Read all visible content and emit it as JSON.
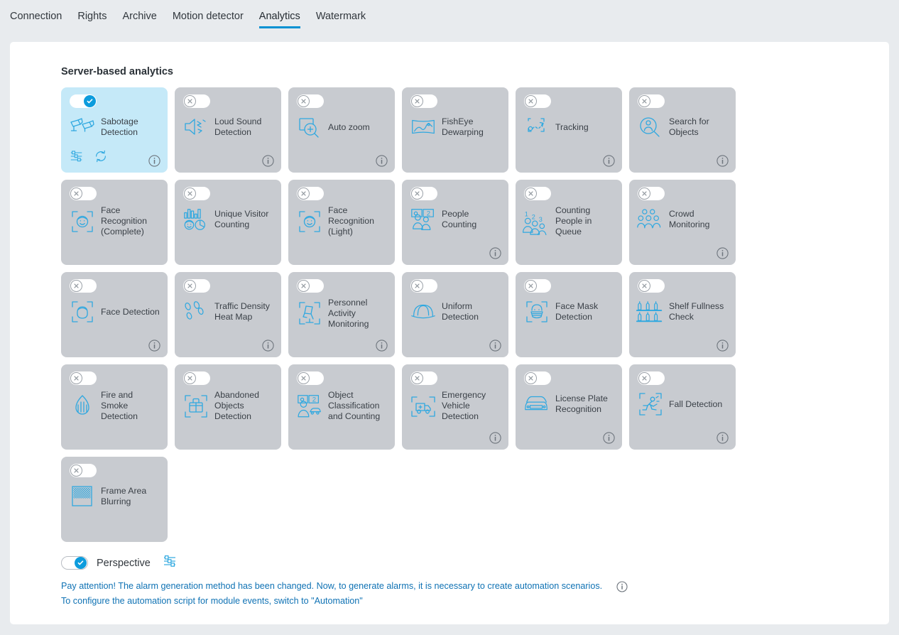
{
  "tabs": [
    {
      "label": "Connection",
      "active": false
    },
    {
      "label": "Rights",
      "active": false
    },
    {
      "label": "Archive",
      "active": false
    },
    {
      "label": "Motion detector",
      "active": false
    },
    {
      "label": "Analytics",
      "active": true
    },
    {
      "label": "Watermark",
      "active": false
    }
  ],
  "section": {
    "title": "Server-based analytics"
  },
  "colors": {
    "accent": "#0091d2",
    "toggle_on": "#0d9cdd",
    "card_off_bg": "#c8cbd0",
    "card_on_bg": "#c5e9f8",
    "icon_blue": "#2fa8e0",
    "link": "#0f72b4",
    "page_bg": "#e8ebee",
    "panel_bg": "#ffffff"
  },
  "cards": [
    {
      "label": "Sabotage Detection",
      "icon": "sabotage-detection-icon",
      "enabled": true,
      "info": true,
      "tools": [
        "settings-sliders-icon",
        "refresh-icon"
      ]
    },
    {
      "label": "Loud Sound Detection",
      "icon": "loud-sound-icon",
      "enabled": false,
      "info": true,
      "tools": []
    },
    {
      "label": "Auto zoom",
      "icon": "auto-zoom-icon",
      "enabled": false,
      "info": true,
      "tools": []
    },
    {
      "label": "FishEye Dewarping",
      "icon": "fisheye-dewarping-icon",
      "enabled": false,
      "info": false,
      "tools": []
    },
    {
      "label": "Tracking",
      "icon": "tracking-icon",
      "enabled": false,
      "info": true,
      "tools": []
    },
    {
      "label": "Search for Objects",
      "icon": "search-objects-icon",
      "enabled": false,
      "info": true,
      "tools": []
    },
    {
      "label": "Face Recognition (Complete)",
      "icon": "face-recognition-complete-icon",
      "enabled": false,
      "info": false,
      "tools": []
    },
    {
      "label": "Unique Visitor Counting",
      "icon": "unique-visitor-counting-icon",
      "enabled": false,
      "info": false,
      "tools": []
    },
    {
      "label": "Face Recognition (Light)",
      "icon": "face-recognition-light-icon",
      "enabled": false,
      "info": false,
      "tools": []
    },
    {
      "label": "People Counting",
      "icon": "people-counting-icon",
      "enabled": false,
      "info": true,
      "tools": []
    },
    {
      "label": "Counting People in Queue",
      "icon": "counting-people-queue-icon",
      "enabled": false,
      "info": false,
      "tools": []
    },
    {
      "label": "Crowd Monitoring",
      "icon": "crowd-monitoring-icon",
      "enabled": false,
      "info": true,
      "tools": []
    },
    {
      "label": "Face Detection",
      "icon": "face-detection-icon",
      "enabled": false,
      "info": true,
      "tools": []
    },
    {
      "label": "Traffic Density Heat Map",
      "icon": "traffic-density-heatmap-icon",
      "enabled": false,
      "info": true,
      "tools": []
    },
    {
      "label": "Personnel Activity Monitoring",
      "icon": "personnel-activity-icon",
      "enabled": false,
      "info": true,
      "tools": []
    },
    {
      "label": "Uniform Detection",
      "icon": "uniform-detection-icon",
      "enabled": false,
      "info": true,
      "tools": []
    },
    {
      "label": "Face Mask Detection",
      "icon": "face-mask-detection-icon",
      "enabled": false,
      "info": false,
      "tools": []
    },
    {
      "label": "Shelf Fullness Check",
      "icon": "shelf-fullness-icon",
      "enabled": false,
      "info": true,
      "tools": []
    },
    {
      "label": "Fire and Smoke Detection",
      "icon": "fire-smoke-icon",
      "enabled": false,
      "info": false,
      "tools": []
    },
    {
      "label": "Abandoned Objects Detection",
      "icon": "abandoned-objects-icon",
      "enabled": false,
      "info": false,
      "tools": []
    },
    {
      "label": "Object Classification and Counting",
      "icon": "object-classification-icon",
      "enabled": false,
      "info": false,
      "tools": []
    },
    {
      "label": "Emergency Vehicle Detection",
      "icon": "emergency-vehicle-icon",
      "enabled": false,
      "info": true,
      "tools": []
    },
    {
      "label": "License Plate Recognition",
      "icon": "license-plate-icon",
      "enabled": false,
      "info": true,
      "tools": []
    },
    {
      "label": "Fall Detection",
      "icon": "fall-detection-icon",
      "enabled": false,
      "info": true,
      "tools": []
    },
    {
      "label": "Frame Area Blurring",
      "icon": "frame-area-blurring-icon",
      "enabled": false,
      "info": false,
      "tools": []
    }
  ],
  "perspective": {
    "label": "Perspective",
    "enabled": true,
    "settings_icon": "settings-sliders-icon"
  },
  "notes": {
    "line1": "Pay attention! The alarm generation method has been changed. Now, to generate alarms, it is necessary to create automation scenarios.",
    "line2": "To configure the automation script for module events, switch to \"Automation\""
  }
}
